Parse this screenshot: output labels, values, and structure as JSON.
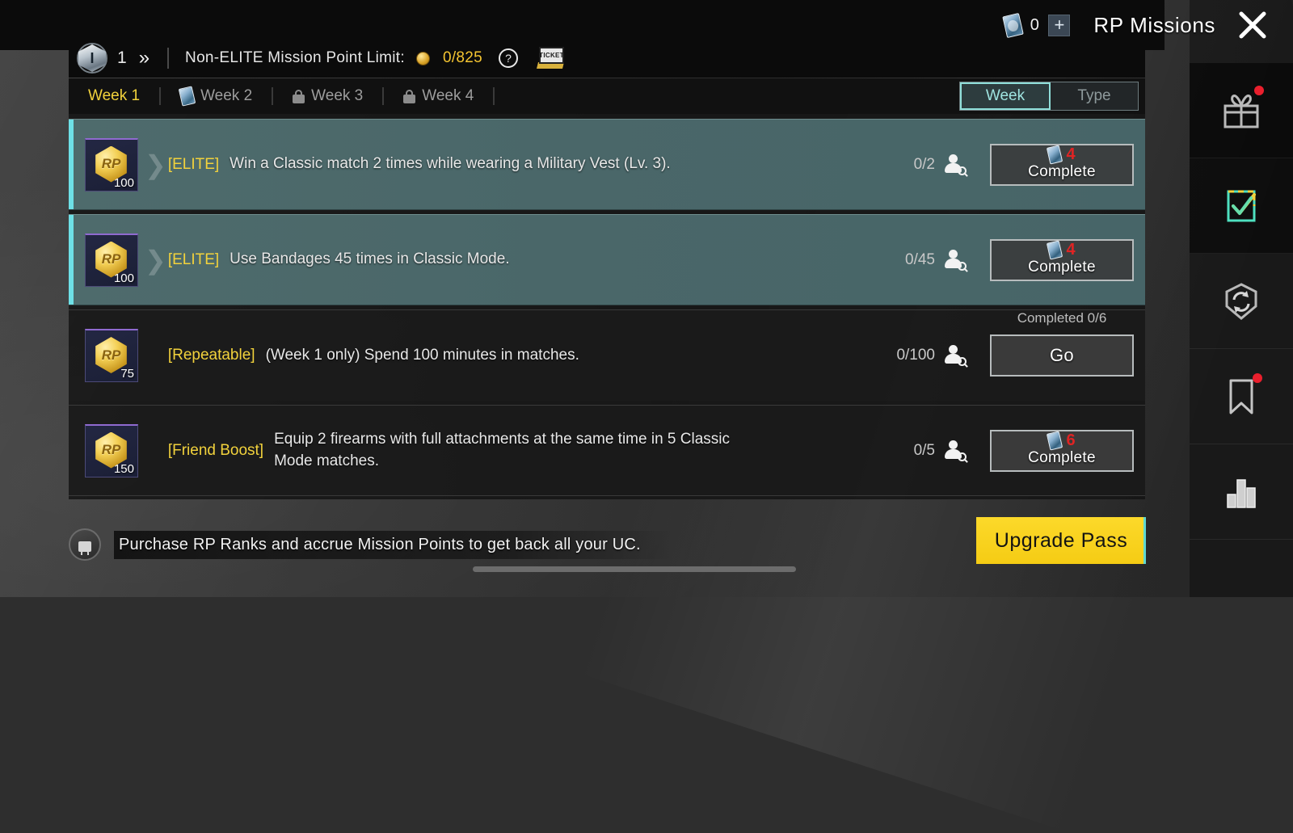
{
  "header": {
    "card_icon": "card-icon",
    "card_count": "0",
    "add_label": "+",
    "title": "RP Missions",
    "close_label": "close-icon"
  },
  "info_bar": {
    "rank_letter": "I",
    "rank_number": "1",
    "next_icon": "»",
    "limit_label": "Non-ELITE Mission Point Limit:",
    "limit_value": "0/825",
    "help_label": "?",
    "ticket_label": "TICKET"
  },
  "tabs": {
    "weeks": [
      {
        "label": "Week 1",
        "state": "active",
        "icon": "none"
      },
      {
        "label": "Week 2",
        "state": "locked-card",
        "icon": "card-icon"
      },
      {
        "label": "Week 3",
        "state": "locked",
        "icon": "lock-icon"
      },
      {
        "label": "Week 4",
        "state": "locked",
        "icon": "lock-icon"
      }
    ],
    "view_toggle": [
      {
        "label": "Week",
        "active": true
      },
      {
        "label": "Type",
        "active": false
      }
    ]
  },
  "missions": [
    {
      "reward_currency": "RP",
      "reward_amount": "100",
      "tag": "[ELITE]",
      "description": "Win a Classic match 2 times while wearing a Military Vest (Lv. 3).",
      "progress": "0/2",
      "friend_icon": "friend-search-icon",
      "action_label": "Complete",
      "action_cost": "4",
      "action_cost_icon": "card-icon",
      "completed_label": "",
      "elite": true
    },
    {
      "reward_currency": "RP",
      "reward_amount": "100",
      "tag": "[ELITE]",
      "description": "Use Bandages 45 times in Classic Mode.",
      "progress": "0/45",
      "friend_icon": "friend-search-icon",
      "action_label": "Complete",
      "action_cost": "4",
      "action_cost_icon": "card-icon",
      "completed_label": "",
      "elite": true
    },
    {
      "reward_currency": "RP",
      "reward_amount": "75",
      "tag": "[Repeatable]",
      "description": "(Week 1 only) Spend 100 minutes in matches.",
      "progress": "0/100",
      "friend_icon": "friend-search-icon",
      "action_label": "Go",
      "action_cost": "",
      "action_cost_icon": "",
      "completed_label": "Completed 0/6",
      "elite": false
    },
    {
      "reward_currency": "RP",
      "reward_amount": "150",
      "tag": "[Friend Boost]",
      "description": "Equip 2 firearms with full attachments at the same time in 5 Classic Mode matches.",
      "progress": "0/5",
      "friend_icon": "friend-search-icon",
      "action_label": "Complete",
      "action_cost": "6",
      "action_cost_icon": "card-icon",
      "completed_label": "",
      "elite": false
    }
  ],
  "footer": {
    "lock_icon": "lock-icon",
    "notice": "Purchase RP Ranks and accrue Mission Points to get back all your UC.",
    "upgrade_label": "Upgrade Pass"
  },
  "right_rail": [
    {
      "icon": "gift-icon",
      "badge": true,
      "active": false
    },
    {
      "icon": "checklist-icon",
      "badge": false,
      "active": true
    },
    {
      "icon": "sync-shield-icon",
      "badge": false,
      "active": false
    },
    {
      "icon": "bookmark-icon",
      "badge": true,
      "active": false
    },
    {
      "icon": "bar-chart-icon",
      "badge": false,
      "active": false
    }
  ],
  "colors": {
    "accent_yellow": "#f2d23c",
    "accent_cyan": "#6ee0e6",
    "elite_row": "#4a6769",
    "cost_red": "#e02424",
    "upgrade_yellow": "#fcd92a"
  }
}
